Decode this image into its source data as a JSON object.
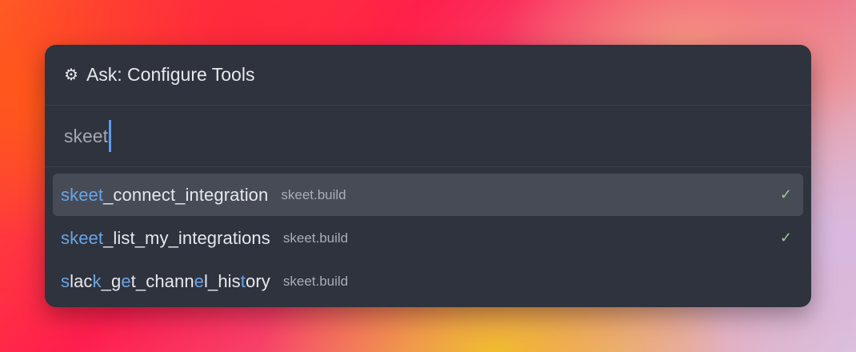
{
  "palette": {
    "title": "Ask: Configure Tools",
    "icon": "gear-icon",
    "search": {
      "value": "skeet"
    },
    "items": [
      {
        "segments": [
          {
            "text": "skeet",
            "hl": true
          },
          {
            "text": "_connect_integration",
            "hl": false
          }
        ],
        "source": "skeet.build",
        "checked": true,
        "selected": true
      },
      {
        "segments": [
          {
            "text": "skeet",
            "hl": true
          },
          {
            "text": "_list_my_integrations",
            "hl": false
          }
        ],
        "source": "skeet.build",
        "checked": true,
        "selected": false
      },
      {
        "segments": [
          {
            "text": "s",
            "hl": true
          },
          {
            "text": "lac",
            "hl": false
          },
          {
            "text": "k",
            "hl": true
          },
          {
            "text": "_g",
            "hl": false
          },
          {
            "text": "e",
            "hl": true
          },
          {
            "text": "t_chann",
            "hl": false
          },
          {
            "text": "e",
            "hl": true
          },
          {
            "text": "l_his",
            "hl": false
          },
          {
            "text": "t",
            "hl": true
          },
          {
            "text": "ory",
            "hl": false
          }
        ],
        "source": "skeet.build",
        "checked": false,
        "selected": false
      }
    ],
    "check_glyph": "✓",
    "colors": {
      "highlight": "#6aa4e6",
      "check": "#9cc98e",
      "background": "#2f333d"
    }
  }
}
